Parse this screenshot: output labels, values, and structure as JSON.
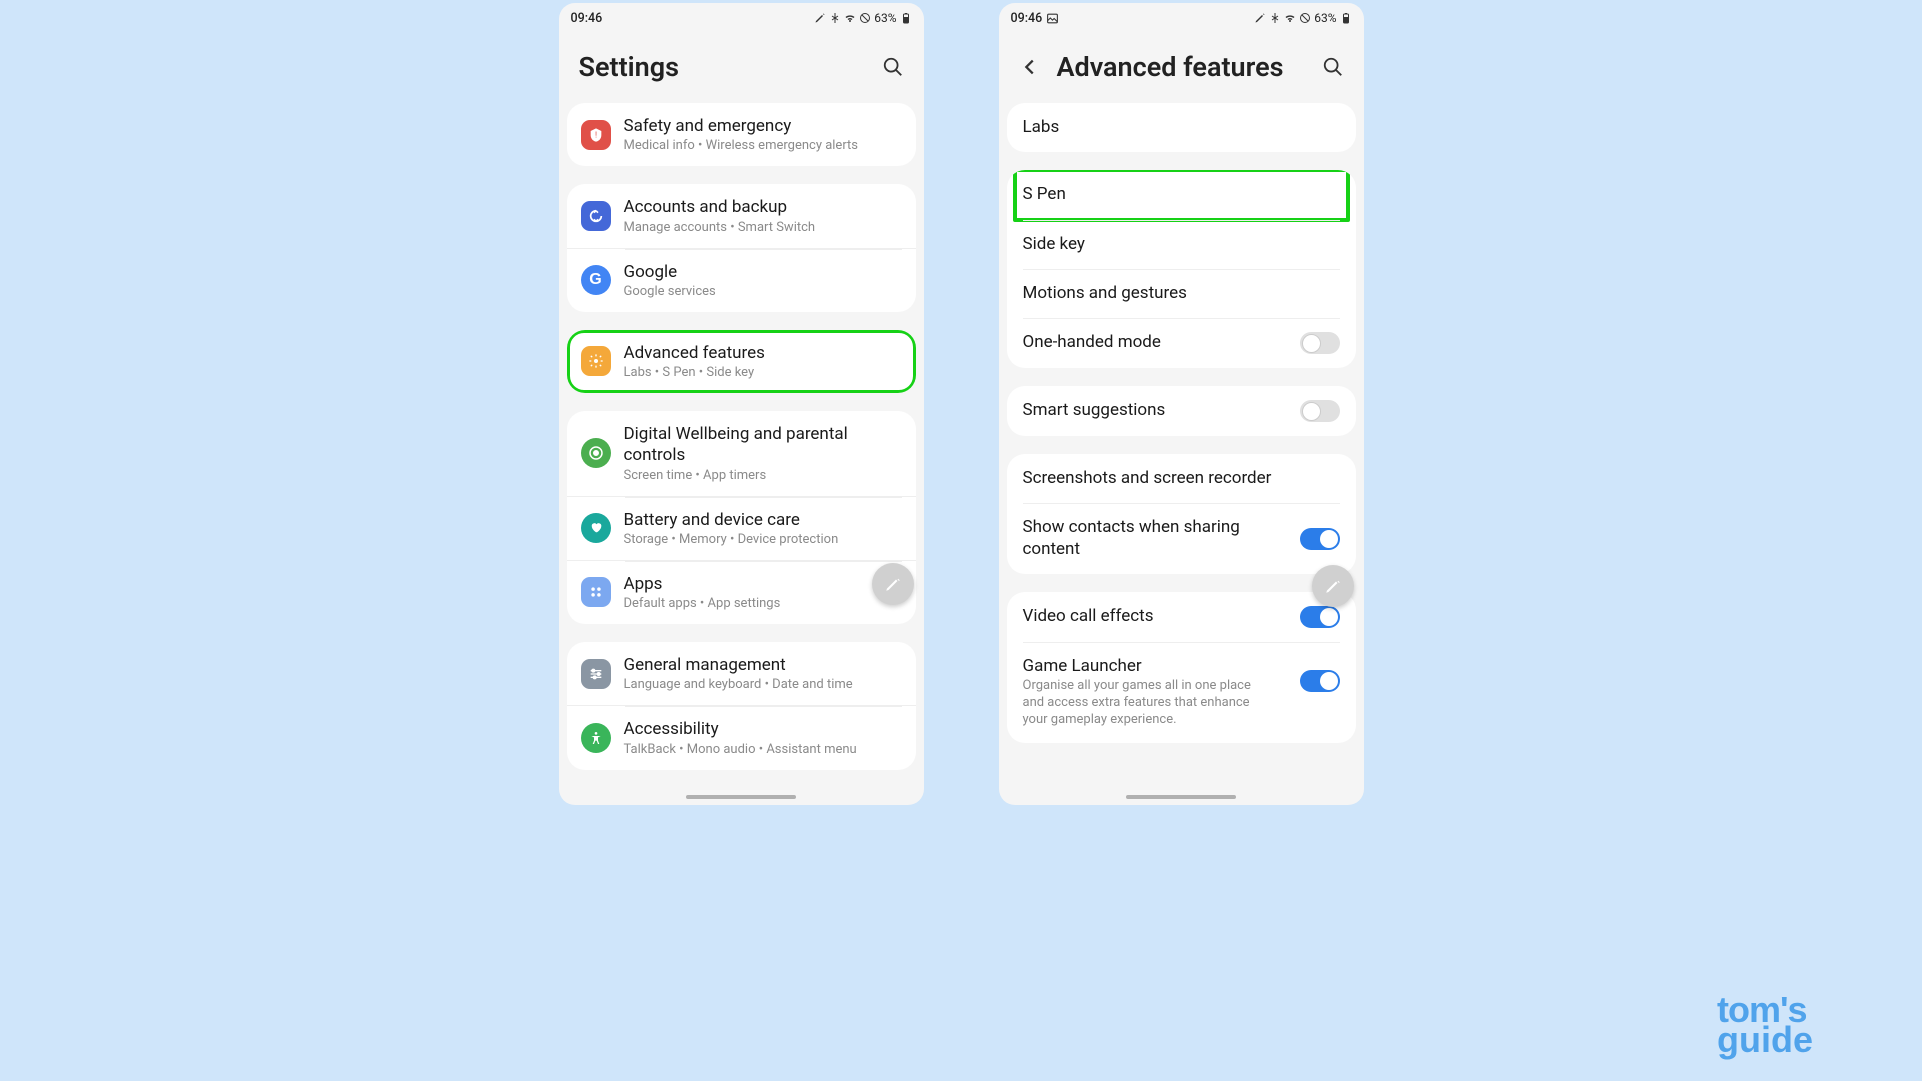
{
  "status": {
    "time": "09:46",
    "battery": "63%"
  },
  "phone1": {
    "title": "Settings",
    "groups": [
      {
        "items": [
          {
            "icon": "safety",
            "title": "Safety and emergency",
            "sub": "Medical info  •  Wireless emergency alerts"
          }
        ]
      },
      {
        "items": [
          {
            "icon": "accounts",
            "title": "Accounts and backup",
            "sub": "Manage accounts  •  Smart Switch"
          },
          {
            "icon": "google",
            "title": "Google",
            "sub": "Google services"
          }
        ]
      },
      {
        "highlight": true,
        "items": [
          {
            "icon": "advanced",
            "title": "Advanced features",
            "sub": "Labs  •  S Pen  •  Side key"
          }
        ]
      },
      {
        "items": [
          {
            "icon": "wellbeing",
            "title": "Digital Wellbeing and parental controls",
            "sub": "Screen time  •  App timers"
          },
          {
            "icon": "battery",
            "title": "Battery and device care",
            "sub": "Storage  •  Memory  •  Device protection"
          },
          {
            "icon": "apps",
            "title": "Apps",
            "sub": "Default apps  •  App settings"
          }
        ]
      },
      {
        "items": [
          {
            "icon": "general",
            "title": "General management",
            "sub": "Language and keyboard  •  Date and time"
          },
          {
            "icon": "accessibility",
            "title": "Accessibility",
            "sub": "TalkBack  •  Mono audio  •  Assistant menu"
          }
        ]
      }
    ]
  },
  "phone2": {
    "title": "Advanced features",
    "groups": [
      {
        "items": [
          {
            "title": "Labs"
          }
        ]
      },
      {
        "items": [
          {
            "title": "S Pen",
            "highlight": true
          },
          {
            "title": "Side key"
          },
          {
            "title": "Motions and gestures"
          },
          {
            "title": "One-handed mode",
            "toggle": "off"
          }
        ]
      },
      {
        "items": [
          {
            "title": "Smart suggestions",
            "toggle": "off"
          }
        ]
      },
      {
        "items": [
          {
            "title": "Screenshots and screen recorder"
          },
          {
            "title": "Show contacts when sharing content",
            "toggle": "on"
          }
        ]
      },
      {
        "items": [
          {
            "title": "Video call effects",
            "toggle": "on"
          },
          {
            "title": "Game Launcher",
            "sub": "Organise all your games all in one place and access extra features that enhance your gameplay experience.",
            "toggle": "on"
          }
        ]
      }
    ]
  },
  "brand": {
    "line1": "tom's",
    "line2": "guide"
  }
}
